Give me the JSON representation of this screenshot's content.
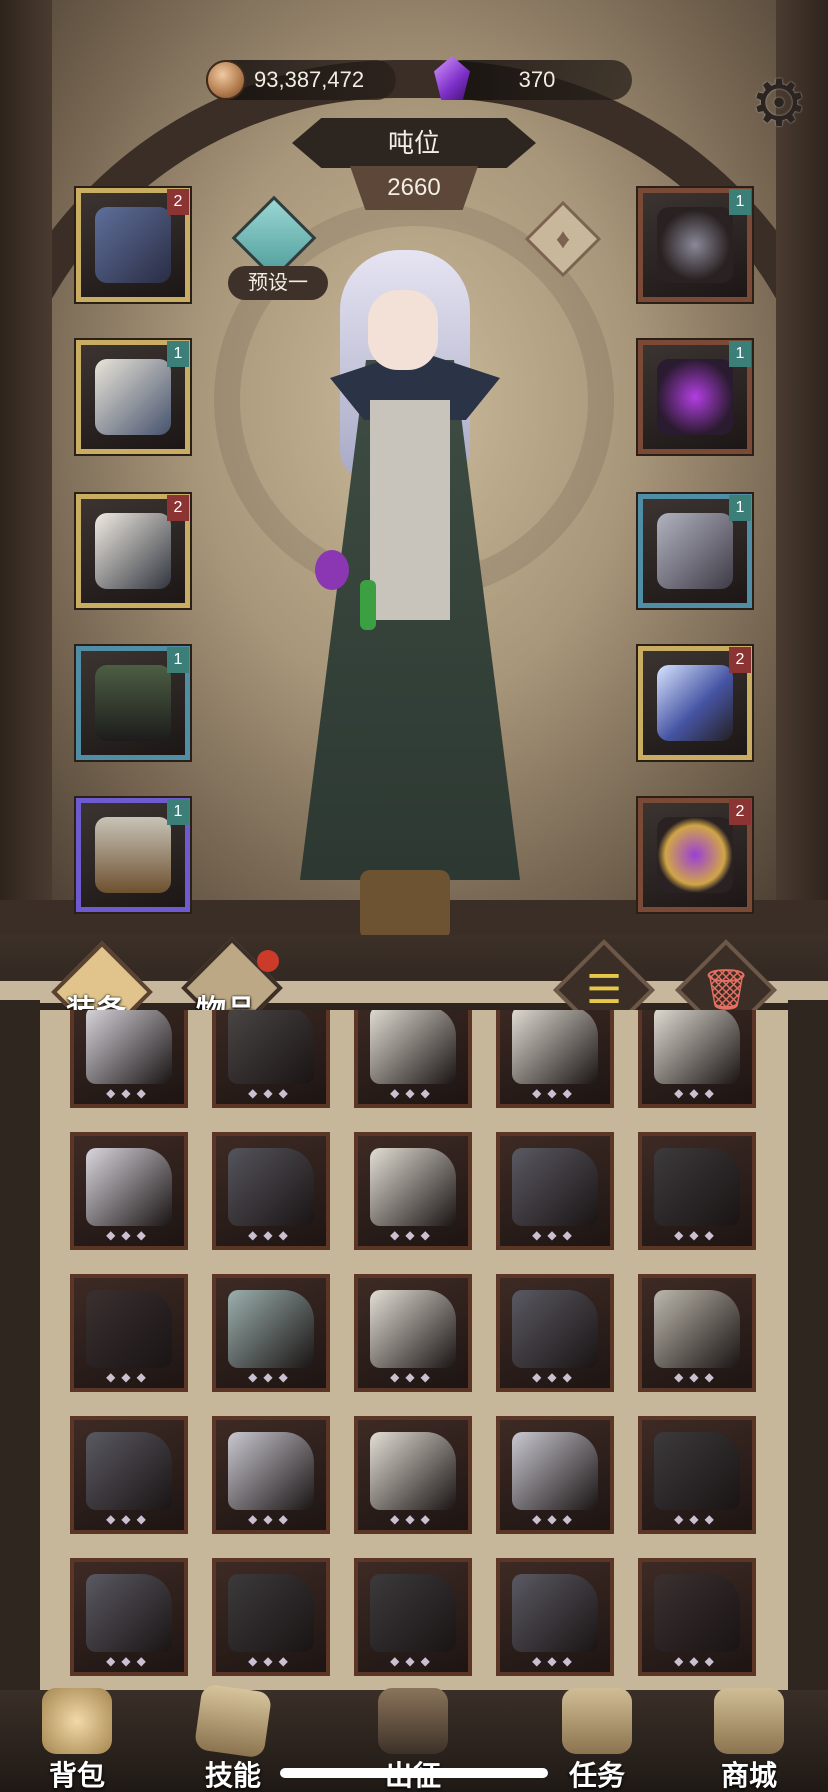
{
  "currency": {
    "gold": "93,387,472",
    "gems": "370"
  },
  "header": {
    "title": "吨位",
    "power": "2660",
    "preset_label": "预设一"
  },
  "equipment": {
    "left": [
      {
        "name": "amulet-star",
        "badge": "2",
        "rarity": "gold"
      },
      {
        "name": "cloak-armor",
        "badge": "1",
        "rarity": "gold"
      },
      {
        "name": "gauntlet",
        "badge": "2",
        "rarity": "gold"
      },
      {
        "name": "pants",
        "badge": "1",
        "rarity": "blue"
      },
      {
        "name": "boots",
        "badge": "1",
        "rarity": "purple"
      }
    ],
    "right": [
      {
        "name": "cross-necklace",
        "badge": "1",
        "rarity": "red"
      },
      {
        "name": "purple-ring",
        "badge": "1",
        "rarity": "red"
      },
      {
        "name": "chain-bracer",
        "badge": "1",
        "rarity": "blue"
      },
      {
        "name": "ice-sword",
        "badge": "2",
        "rarity": "gold"
      },
      {
        "name": "orb-relic",
        "badge": "2",
        "rarity": "red"
      }
    ]
  },
  "tabs": {
    "equipment": "装备",
    "items": "物品"
  },
  "inventory": {
    "rows": [
      [
        "#d9d6dd",
        "#4a4645",
        "#e2ded4",
        "#e2ded4",
        "#e2ded4"
      ],
      [
        "#d9d6dd",
        "#55545c",
        "#e2ded4",
        "#5a5962",
        "#3c3a3c"
      ],
      [
        "#3a3030",
        "#9bb0ad",
        "#e2ded4",
        "#5a5962",
        "#bdb8ad"
      ],
      [
        "#5a5962",
        "#c9c8d0",
        "#e2ded4",
        "#c9c8d0",
        "#3c3a3c"
      ],
      [
        "#5a5962",
        "#3c3a3c",
        "#3c3a3c",
        "#5a5962",
        "#3a3030"
      ]
    ]
  },
  "nav": {
    "items": [
      {
        "label": "背包",
        "icon": "backpack-icon"
      },
      {
        "label": "技能",
        "icon": "skill-card-icon"
      },
      {
        "label": "出征",
        "icon": "expedition-icon"
      },
      {
        "label": "任务",
        "icon": "quest-scroll-icon"
      },
      {
        "label": "商城",
        "icon": "shop-icon"
      }
    ]
  }
}
